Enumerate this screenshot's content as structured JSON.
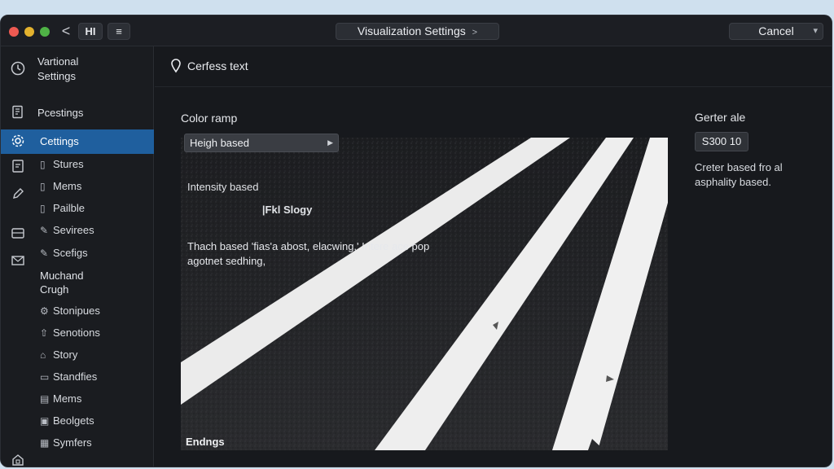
{
  "titlebar": {
    "hi_label": "HI",
    "list_label": "≡",
    "back_label": "<",
    "title": "Visualization Settings",
    "title_chevron": ">",
    "cancel_label": "Cancel",
    "cancel_chevron": "▾"
  },
  "sidebar": {
    "items": [
      {
        "label": "Vartional\nSettings",
        "icon": "clock-icon"
      },
      {
        "label": "Pcestings",
        "icon": "document-icon"
      },
      {
        "label": "Cettings",
        "icon": "gear-icon",
        "active": true
      }
    ],
    "subitems_a": [
      {
        "label": "Stures",
        "icon": "box-icon"
      },
      {
        "label": "Mems",
        "icon": "box-icon"
      },
      {
        "label": "Pailble",
        "icon": "box-icon"
      },
      {
        "label": "Sevirees",
        "icon": "pencil-icon"
      },
      {
        "label": "Scefigs",
        "icon": "pencil-icon"
      }
    ],
    "group_label": "Muchand\nCrugh",
    "subitems_b": [
      {
        "label": "Stonipues",
        "icon": "gear-icon"
      },
      {
        "label": "Senotions",
        "icon": "arrow-icon"
      },
      {
        "label": "Story",
        "icon": "home-icon"
      },
      {
        "label": "Standfies",
        "icon": "folder-icon"
      },
      {
        "label": "Mems",
        "icon": "list-icon"
      },
      {
        "label": "Beolgets",
        "icon": "box-icon"
      },
      {
        "label": "Symfers",
        "icon": "box-icon"
      }
    ],
    "left_icons": [
      "clipboard-icon",
      "pen-icon",
      "tray-icon",
      "mail-icon",
      "home-lock-icon"
    ]
  },
  "main": {
    "header_text": "Cerfess text",
    "color_ramp_label": "Color ramp",
    "dropdown_value": "Heigh based",
    "option_1": "Intensity based",
    "option_2": "|Fkl Slogy",
    "description": "Thach based 'fias'a abost, elacwing,' Intere ace pop agotnet sedhing,",
    "image_caption": "Endngs"
  },
  "right_panel": {
    "label": "Gerter ale",
    "value": "S300 10",
    "description": "Creter based fro al asphality based."
  },
  "colors": {
    "accent": "#1f5f9e",
    "window_bg": "#16181c",
    "traffic_red": "#ee5a52",
    "traffic_yellow": "#e3b22e",
    "traffic_green": "#4fb346"
  }
}
